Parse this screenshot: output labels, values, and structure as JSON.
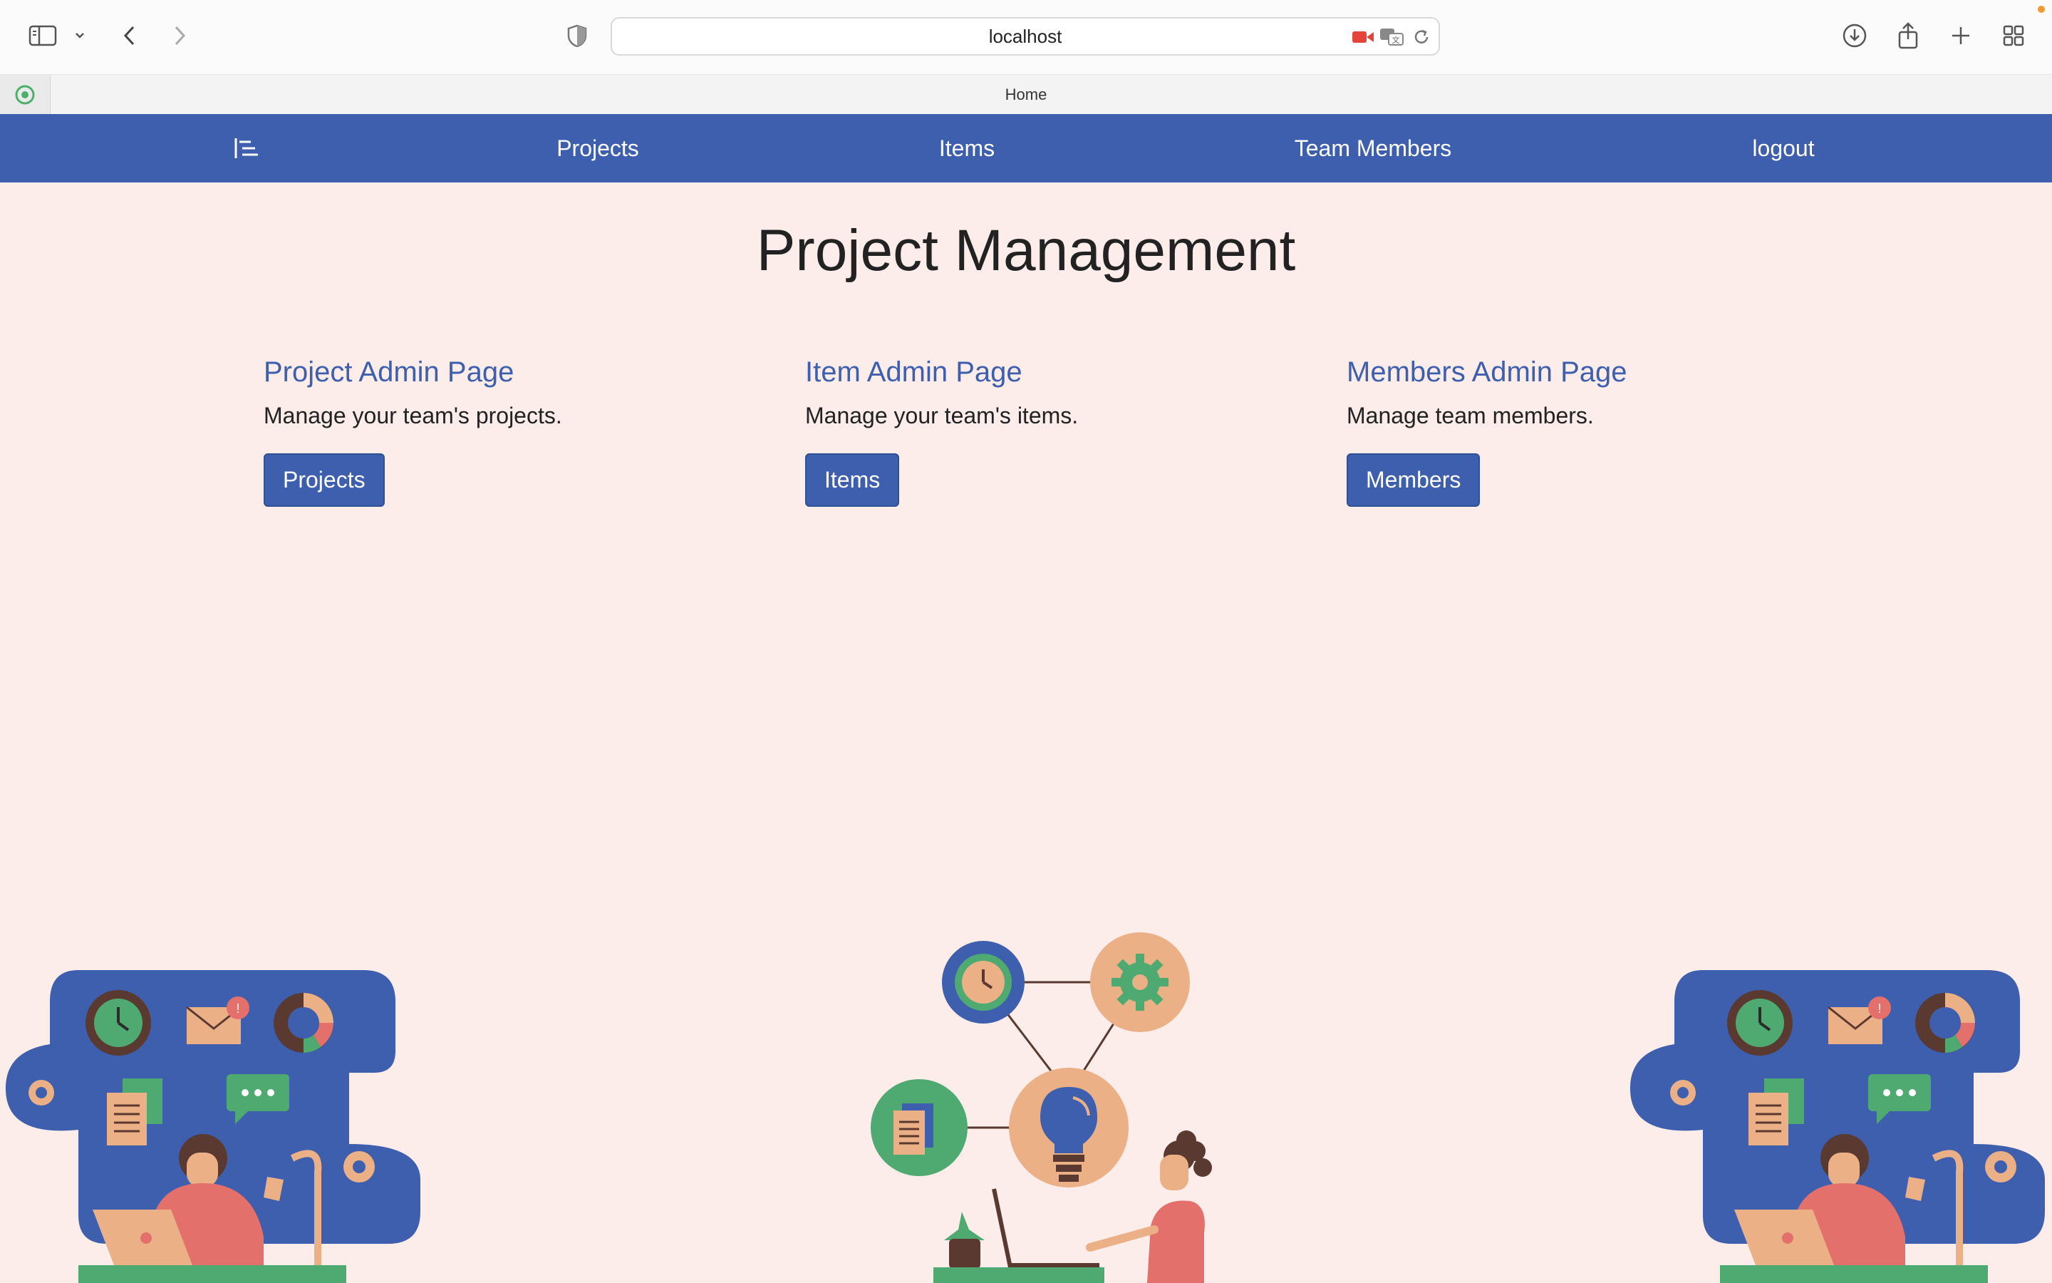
{
  "browser": {
    "url": "localhost",
    "tab_title": "Home"
  },
  "nav": {
    "items": [
      "Projects",
      "Items",
      "Team Members",
      "logout"
    ]
  },
  "page": {
    "title": "Project Management"
  },
  "cards": [
    {
      "title": "Project Admin Page",
      "description": "Manage your team's projects.",
      "button": "Projects"
    },
    {
      "title": "Item Admin Page",
      "description": "Manage your team's items.",
      "button": "Items"
    },
    {
      "title": "Members Admin Page",
      "description": "Manage team members.",
      "button": "Members"
    }
  ],
  "colors": {
    "primary": "#3d5fae",
    "background": "#fcecea",
    "green": "#4faa72",
    "peach": "#ecb087",
    "coral": "#e4706b",
    "dark": "#5a3a30"
  }
}
